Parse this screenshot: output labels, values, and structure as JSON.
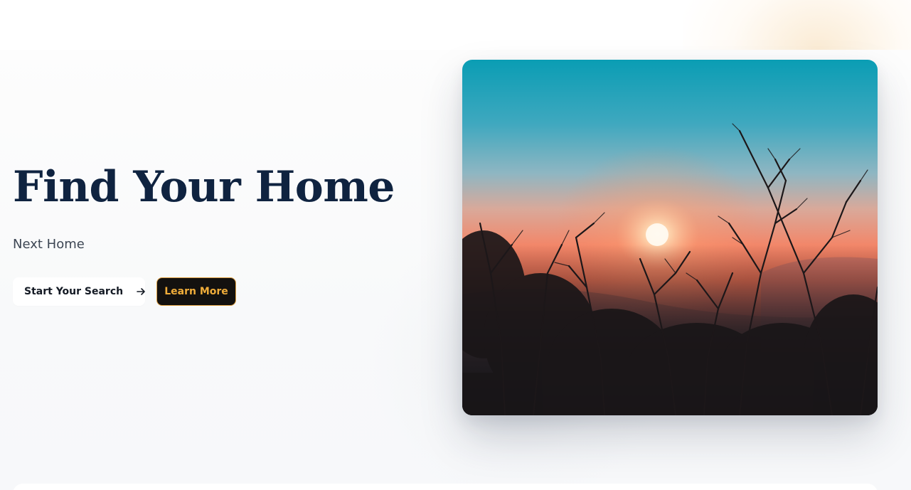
{
  "hero": {
    "title": "Find Your Home",
    "subtitle": "Next Home",
    "primary_button": {
      "label": "Start Your Search",
      "icon": "arrow-right-icon"
    },
    "secondary_button": {
      "label": "Learn More"
    },
    "image": {
      "subject": "sunset-through-branches"
    }
  },
  "colors": {
    "title": "#0f2340",
    "accent": "#f0ad3a",
    "dark_button_bg": "#13110f",
    "sky_top": "#0aa0b8",
    "sunset": "#f07a55"
  }
}
